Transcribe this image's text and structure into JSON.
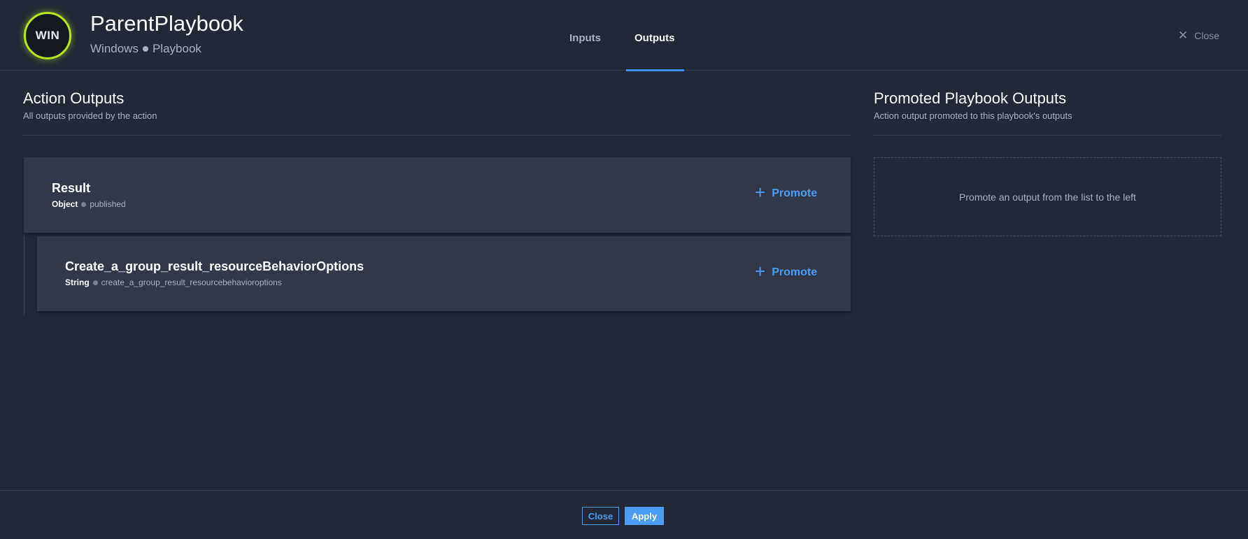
{
  "header": {
    "avatar_text": "WIN",
    "title": "ParentPlaybook",
    "subtitle_left": "Windows",
    "subtitle_right": "Playbook",
    "tabs": [
      {
        "label": "Inputs",
        "active": false
      },
      {
        "label": "Outputs",
        "active": true
      }
    ],
    "close_label": "Close"
  },
  "action_outputs": {
    "title": "Action Outputs",
    "subtitle": "All outputs provided by the action",
    "items": [
      {
        "name": "Result",
        "type": "Object",
        "path": "published",
        "promote_label": "Promote"
      },
      {
        "name": "Create_a_group_result_resourceBehaviorOptions",
        "type": "String",
        "path": "create_a_group_result_resourcebehavioroptions",
        "promote_label": "Promote"
      }
    ]
  },
  "promoted_outputs": {
    "title": "Promoted Playbook Outputs",
    "subtitle": "Action output promoted to this playbook's outputs",
    "empty_text": "Promote an output from the list to the left"
  },
  "footer": {
    "close_label": "Close",
    "apply_label": "Apply"
  },
  "colors": {
    "background": "#232836",
    "card": "#323848",
    "accent": "#4a9cf5",
    "avatar_ring": "#b5e61d"
  }
}
